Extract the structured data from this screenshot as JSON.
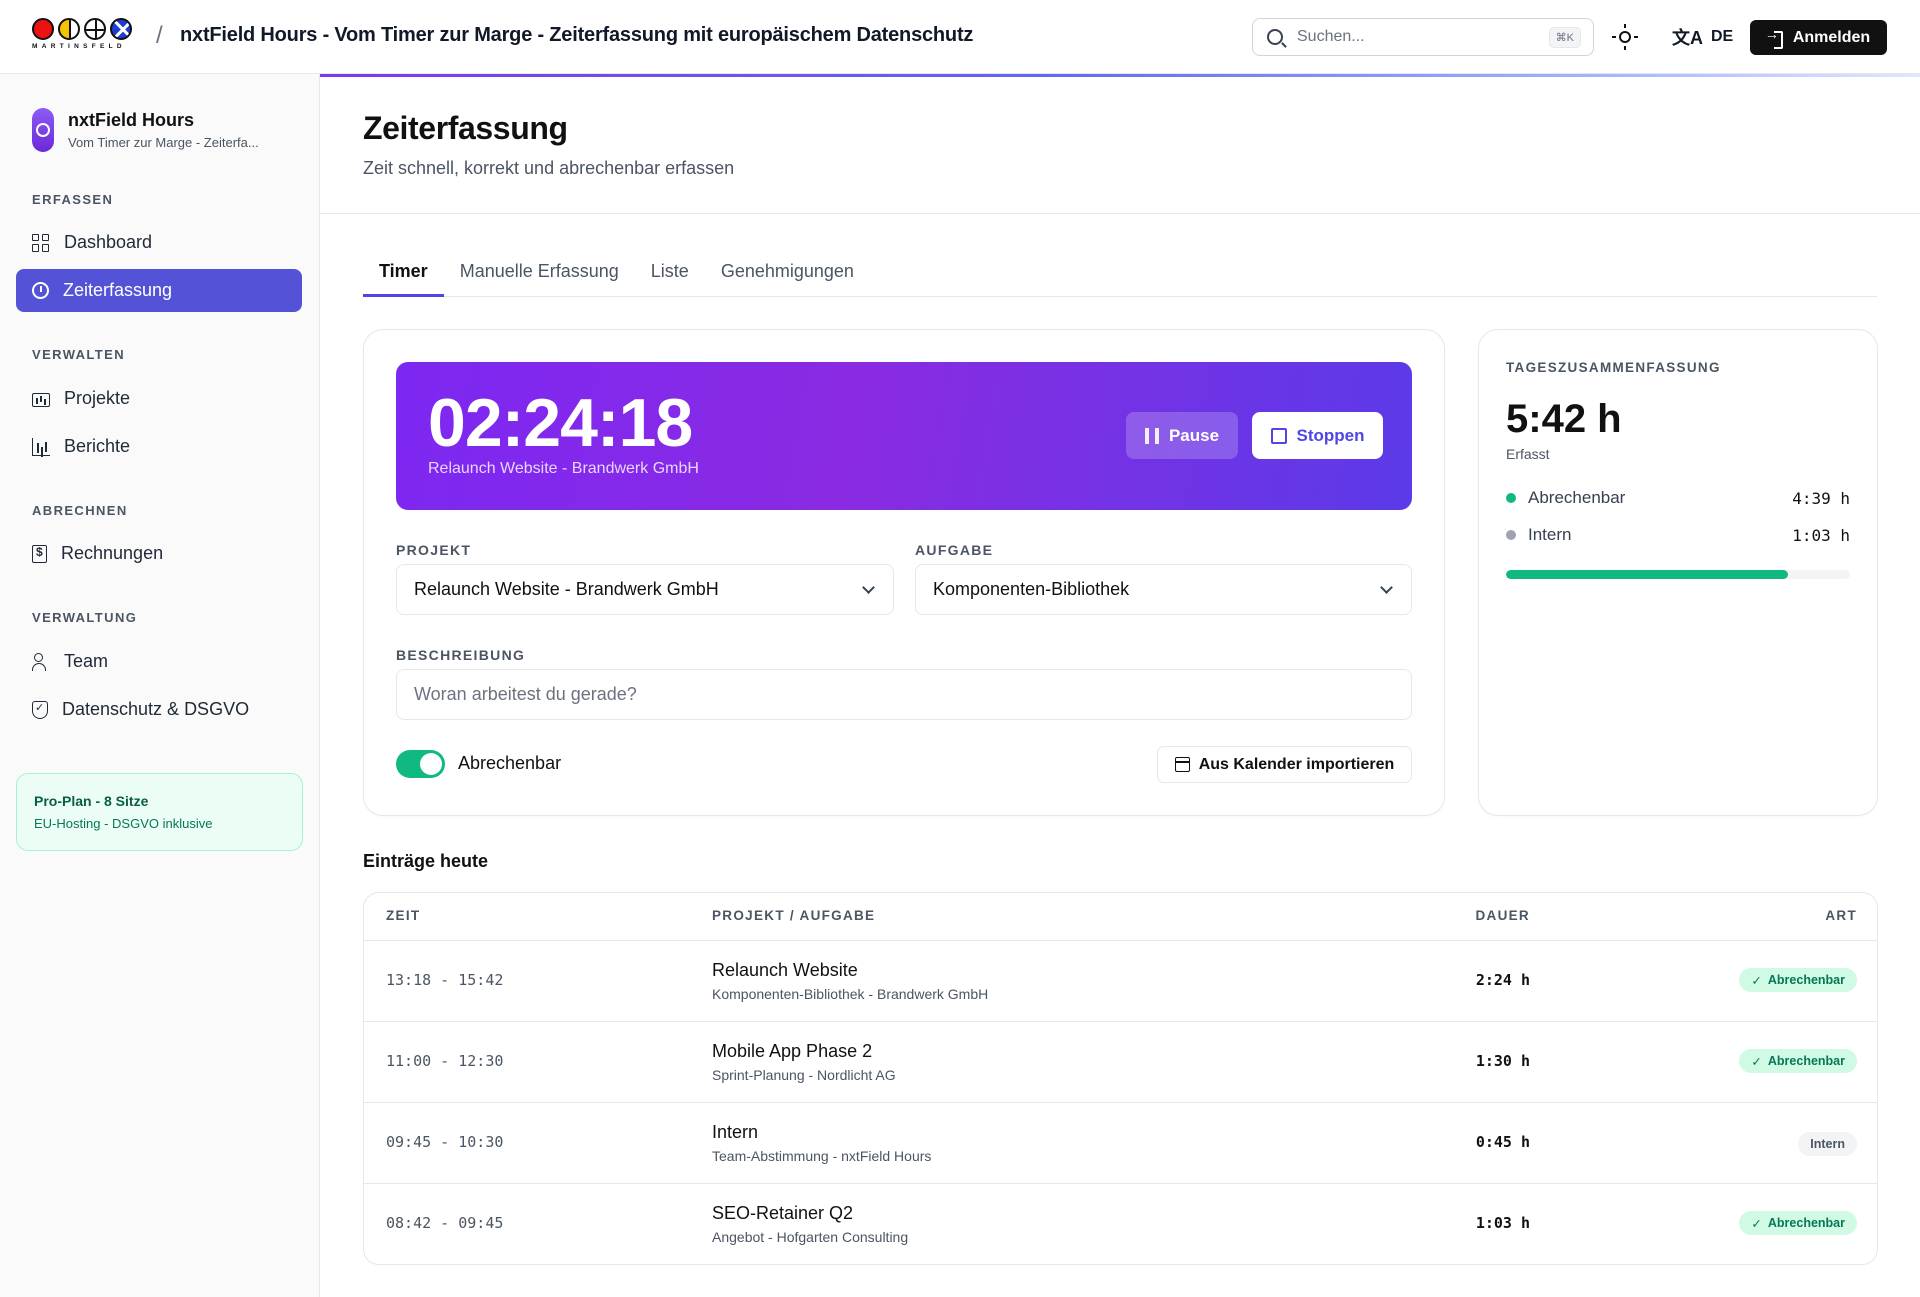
{
  "header": {
    "logo_text": "MARTINSFELD",
    "separator": "/",
    "title": "nxtField Hours - Vom Timer zur Marge - Zeiterfassung mit europäischem Datenschutz",
    "search_placeholder": "Suchen...",
    "search_shortcut": "⌘K",
    "theme_icon": "sun-icon",
    "language": "DE",
    "login_label": "Anmelden"
  },
  "sidebar": {
    "app_name": "nxtField Hours",
    "app_subtitle": "Vom Timer zur Marge - Zeiterfa...",
    "sections": [
      {
        "title": "ERFASSEN",
        "items": [
          {
            "label": "Dashboard",
            "icon": "dashboard-icon"
          },
          {
            "label": "Zeiterfassung",
            "icon": "timer-icon",
            "active": true
          }
        ]
      },
      {
        "title": "VERWALTEN",
        "items": [
          {
            "label": "Projekte",
            "icon": "folder-icon"
          },
          {
            "label": "Berichte",
            "icon": "chart-icon"
          }
        ]
      },
      {
        "title": "ABRECHNEN",
        "items": [
          {
            "label": "Rechnungen",
            "icon": "invoice-icon"
          }
        ]
      },
      {
        "title": "VERWALTUNG",
        "items": [
          {
            "label": "Team",
            "icon": "team-icon"
          },
          {
            "label": "Datenschutz & DSGVO",
            "icon": "shield-icon"
          }
        ]
      }
    ],
    "plan": {
      "title": "Pro-Plan - 8 Sitze",
      "subtitle": "EU-Hosting - DSGVO inklusive"
    }
  },
  "main": {
    "title": "Zeiterfassung",
    "subtitle": "Zeit schnell, korrekt und abrechenbar erfassen",
    "tabs": [
      "Timer",
      "Manuelle Erfassung",
      "Liste",
      "Genehmigungen"
    ],
    "active_tab": "Timer",
    "timer": {
      "value": "02:24:18",
      "project": "Relaunch Website - Brandwerk GmbH",
      "pause_label": "Pause",
      "stop_label": "Stoppen",
      "project_label": "PROJEKT",
      "project_value": "Relaunch Website - Brandwerk GmbH",
      "task_label": "AUFGABE",
      "task_value": "Komponenten-Bibliothek",
      "description_label": "BESCHREIBUNG",
      "description_placeholder": "Woran arbeitest du gerade?",
      "billable_label": "Abrechenbar",
      "billable_on": true,
      "import_label": "Aus Kalender importieren"
    },
    "summary": {
      "label": "TAGESZUSAMMENFASSUNG",
      "total": "5:42 h",
      "caption": "Erfasst",
      "rows": [
        {
          "label": "Abrechenbar",
          "value": "4:39 h",
          "color": "#10b981"
        },
        {
          "label": "Intern",
          "value": "1:03 h",
          "color": "#9ca3af"
        }
      ],
      "billable_fraction": 0.82
    },
    "entries": {
      "title": "Einträge heute",
      "columns": [
        "ZEIT",
        "PROJEKT / AUFGABE",
        "DAUER",
        "ART"
      ],
      "rows": [
        {
          "time": "13:18 - 15:42",
          "project": "Relaunch Website",
          "task": "Komponenten-Bibliothek - Brandwerk GmbH",
          "duration": "2:24 h",
          "type": "Abrechenbar"
        },
        {
          "time": "11:00 - 12:30",
          "project": "Mobile App Phase 2",
          "task": "Sprint-Planung - Nordlicht AG",
          "duration": "1:30 h",
          "type": "Abrechenbar"
        },
        {
          "time": "09:45 - 10:30",
          "project": "Intern",
          "task": "Team-Abstimmung - nxtField Hours",
          "duration": "0:45 h",
          "type": "Intern"
        },
        {
          "time": "08:42 - 09:45",
          "project": "SEO-Retainer Q2",
          "task": "Angebot - Hofgarten Consulting",
          "duration": "1:03 h",
          "type": "Abrechenbar"
        }
      ]
    },
    "colors": {
      "accent": "#5453d8",
      "billable": "#10b981",
      "brand_gradient_start": "#7c27f2",
      "brand_gradient_end": "#5b3ae8"
    }
  }
}
